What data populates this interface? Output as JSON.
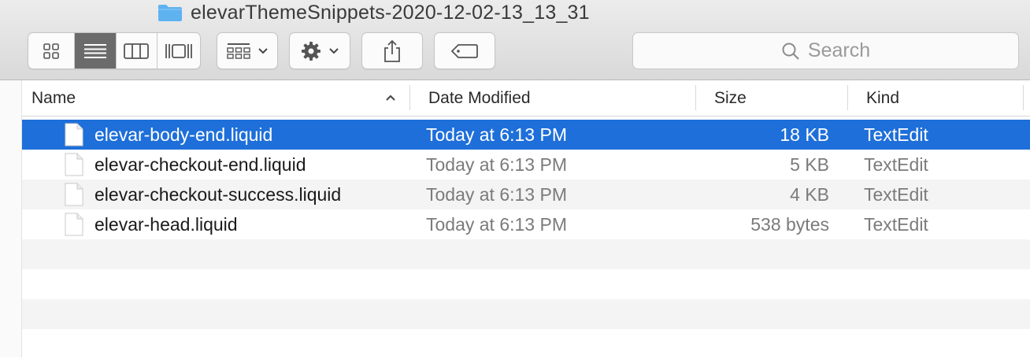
{
  "window": {
    "title": "elevarThemeSnippets-2020-12-02-13_13_31",
    "title_icon": "folder-icon"
  },
  "toolbar": {
    "view_modes": [
      {
        "name": "icon-view",
        "icon": "grid-icon",
        "active": false
      },
      {
        "name": "list-view",
        "icon": "list-icon",
        "active": true
      },
      {
        "name": "column-view",
        "icon": "columns-icon",
        "active": false
      },
      {
        "name": "gallery-view",
        "icon": "gallery-icon",
        "active": false
      }
    ],
    "group_icon": "group-grid-icon",
    "action_icon": "gear-icon",
    "share_icon": "share-icon",
    "tag_icon": "tag-icon",
    "search": {
      "placeholder": "Search",
      "icon": "magnifier-icon"
    }
  },
  "columns": {
    "name": "Name",
    "date": "Date Modified",
    "size": "Size",
    "kind": "Kind",
    "sort_indicator": "^"
  },
  "files": [
    {
      "name": "elevar-body-end.liquid",
      "date": "Today at 6:13 PM",
      "size": "18 KB",
      "kind": "TextEdit",
      "selected": true
    },
    {
      "name": "elevar-checkout-end.liquid",
      "date": "Today at 6:13 PM",
      "size": "5 KB",
      "kind": "TextEdit",
      "selected": false
    },
    {
      "name": "elevar-checkout-success.liquid",
      "date": "Today at 6:13 PM",
      "size": "4 KB",
      "kind": "TextEdit",
      "selected": false
    },
    {
      "name": "elevar-head.liquid",
      "date": "Today at 6:13 PM",
      "size": "538 bytes",
      "kind": "TextEdit",
      "selected": false
    }
  ],
  "colors": {
    "selection": "#1e6fd9",
    "folder": "#5fb2f0",
    "toolbar_bg": "#e3e3e3"
  }
}
